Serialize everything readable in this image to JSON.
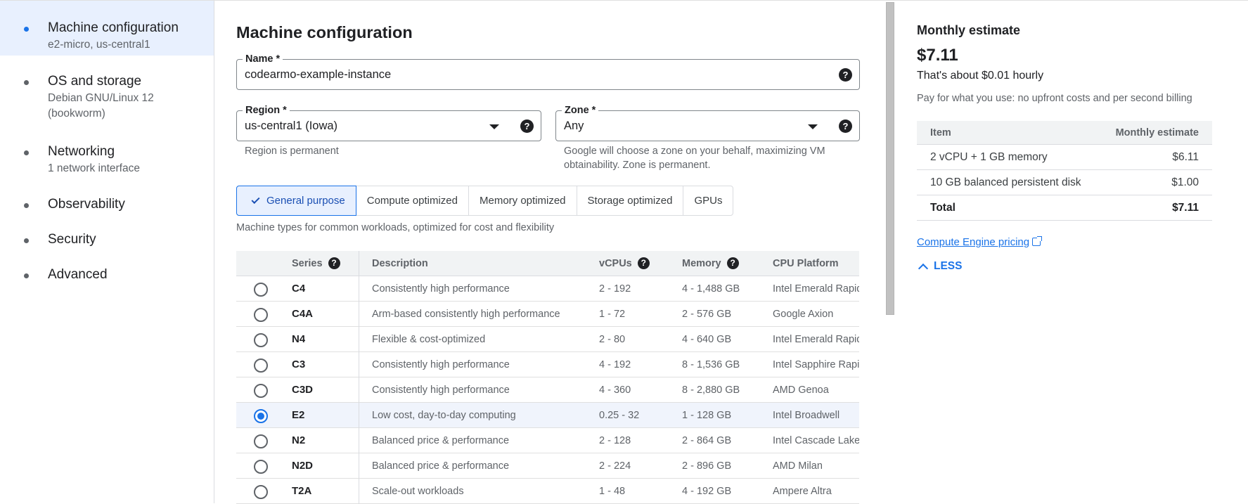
{
  "nav": {
    "items": [
      {
        "label": "Machine configuration",
        "sub": "e2-micro, us-central1"
      },
      {
        "label": "OS and storage",
        "sub": "Debian GNU/Linux 12",
        "sub2": "(bookworm)"
      },
      {
        "label": "Networking",
        "sub": "1 network interface"
      },
      {
        "label": "Observability"
      },
      {
        "label": "Security"
      },
      {
        "label": "Advanced"
      }
    ]
  },
  "main": {
    "title": "Machine configuration",
    "name": {
      "label": "Name *",
      "value": "codearmo-example-instance"
    },
    "region": {
      "label": "Region *",
      "value": "us-central1 (Iowa)",
      "hint": "Region is permanent"
    },
    "zone": {
      "label": "Zone *",
      "value": "Any",
      "hint_line1": "Google will choose a zone on your behalf, maximizing VM",
      "hint_line2": "obtainability. Zone is permanent."
    },
    "help_glyph": "?",
    "tabs": [
      "General purpose",
      "Compute optimized",
      "Memory optimized",
      "Storage optimized",
      "GPUs"
    ],
    "tab_description": "Machine types for common workloads, optimized for cost and flexibility",
    "table": {
      "headers": {
        "series": "Series",
        "description": "Description",
        "vcpus": "vCPUs",
        "memory": "Memory",
        "platform": "CPU Platform"
      },
      "rows": [
        {
          "series": "C4",
          "description": "Consistently high performance",
          "vcpus": "2 - 192",
          "memory": "4 - 1,488 GB",
          "platform": "Intel Emerald Rapids",
          "selected": false
        },
        {
          "series": "C4A",
          "description": "Arm-based consistently high performance",
          "vcpus": "1 - 72",
          "memory": "2 - 576 GB",
          "platform": "Google Axion",
          "selected": false
        },
        {
          "series": "N4",
          "description": "Flexible & cost-optimized",
          "vcpus": "2 - 80",
          "memory": "4 - 640 GB",
          "platform": "Intel Emerald Rapids",
          "selected": false
        },
        {
          "series": "C3",
          "description": "Consistently high performance",
          "vcpus": "4 - 192",
          "memory": "8 - 1,536 GB",
          "platform": "Intel Sapphire Rapids",
          "selected": false
        },
        {
          "series": "C3D",
          "description": "Consistently high performance",
          "vcpus": "4 - 360",
          "memory": "8 - 2,880 GB",
          "platform": "AMD Genoa",
          "selected": false
        },
        {
          "series": "E2",
          "description": "Low cost, day-to-day computing",
          "vcpus": "0.25 - 32",
          "memory": "1 - 128 GB",
          "platform": "Intel Broadwell",
          "selected": true
        },
        {
          "series": "N2",
          "description": "Balanced price & performance",
          "vcpus": "2 - 128",
          "memory": "2 - 864 GB",
          "platform": "Intel Cascade Lake",
          "selected": false
        },
        {
          "series": "N2D",
          "description": "Balanced price & performance",
          "vcpus": "2 - 224",
          "memory": "2 - 896 GB",
          "platform": "AMD Milan",
          "selected": false
        },
        {
          "series": "T2A",
          "description": "Scale-out workloads",
          "vcpus": "1 - 48",
          "memory": "4 - 192 GB",
          "platform": "Ampere Altra",
          "selected": false
        }
      ]
    }
  },
  "estimate": {
    "title": "Monthly estimate",
    "price": "$7.11",
    "hourly": "That's about $0.01 hourly",
    "pay_note": "Pay for what you use: no upfront costs and per second billing",
    "table_headers": {
      "item": "Item",
      "estimate": "Monthly estimate"
    },
    "rows": [
      {
        "item": "2 vCPU + 1 GB memory",
        "cost": "$6.11"
      },
      {
        "item": "10 GB balanced persistent disk",
        "cost": "$1.00"
      },
      {
        "item": "Total",
        "cost": "$7.11"
      }
    ],
    "pricing_link": "Compute Engine pricing",
    "less": "LESS"
  },
  "colors": {
    "accent": "#1a73e8",
    "selected_bg": "#e8f0fe"
  }
}
